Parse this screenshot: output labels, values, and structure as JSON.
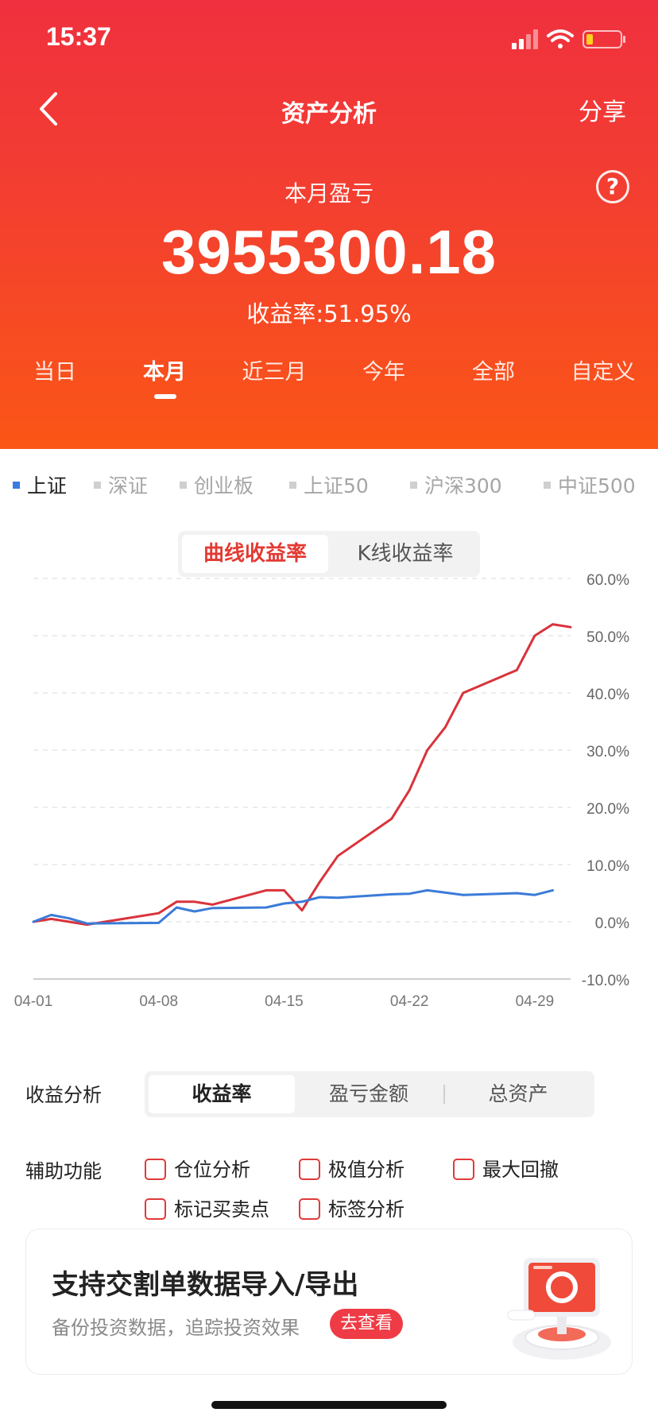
{
  "status_bar": {
    "time": "15:37"
  },
  "nav": {
    "title": "资产分析",
    "share": "分享"
  },
  "summary": {
    "label": "本月盈亏",
    "value": "3955300.18",
    "rate": "收益率:51.95%",
    "help_icon": "?"
  },
  "period_tabs": [
    {
      "label": "当日"
    },
    {
      "label": "本月",
      "active": true
    },
    {
      "label": "近三月"
    },
    {
      "label": "今年"
    },
    {
      "label": "全部"
    },
    {
      "label": "自定义"
    }
  ],
  "index_tabs": [
    {
      "label": "上证",
      "active": true
    },
    {
      "label": "深证"
    },
    {
      "label": "创业板"
    },
    {
      "label": "上证50"
    },
    {
      "label": "沪深300"
    },
    {
      "label": "中证500"
    }
  ],
  "chart_toggle": {
    "active": "曲线收益率",
    "inactive": "K线收益率"
  },
  "chart_data": {
    "type": "line",
    "x_ticks": [
      "04-01",
      "04-08",
      "04-15",
      "04-22",
      "04-29"
    ],
    "y_ticks": [
      "60.0%",
      "50.0%",
      "40.0%",
      "30.0%",
      "20.0%",
      "10.0%",
      "0.0%",
      "-10.0%"
    ],
    "ylim": [
      -10,
      60
    ],
    "grid": true,
    "series": [
      {
        "color": "#d9333b",
        "x": [
          0,
          1,
          3,
          7,
          8,
          9,
          10,
          13,
          14,
          15,
          16,
          17,
          20,
          21,
          22,
          23,
          24,
          27,
          28,
          29,
          30
        ],
        "values": [
          0,
          0.5,
          -0.5,
          1.5,
          3.5,
          3.5,
          3.0,
          5.5,
          5.5,
          2.0,
          7.0,
          11.5,
          18.0,
          23.0,
          30.0,
          34.0,
          40.0,
          44.0,
          50.0,
          52.0,
          51.5
        ]
      },
      {
        "color": "#3b7bd8",
        "x": [
          0,
          1,
          2,
          3,
          7,
          8,
          9,
          10,
          13,
          14,
          15,
          16,
          17,
          20,
          21,
          22,
          23,
          24,
          27,
          28,
          29
        ],
        "values": [
          0,
          1.2,
          0.6,
          -0.3,
          -0.2,
          2.5,
          1.8,
          2.4,
          2.5,
          3.2,
          3.5,
          4.3,
          4.2,
          4.8,
          4.9,
          5.5,
          5.1,
          4.7,
          5.0,
          4.7,
          5.5
        ]
      }
    ]
  },
  "analysis": {
    "label": "收益分析",
    "options": [
      {
        "label": "收益率",
        "active": true
      },
      {
        "label": "盈亏金额"
      },
      {
        "label": "总资产"
      }
    ]
  },
  "aux": {
    "label": "辅助功能",
    "items": [
      {
        "label": "仓位分析"
      },
      {
        "label": "极值分析"
      },
      {
        "label": "最大回撤"
      },
      {
        "label": "标记买卖点"
      },
      {
        "label": "标签分析"
      }
    ]
  },
  "promo": {
    "title": "支持交割单数据导入/导出",
    "subtitle": "备份投资数据，追踪投资效果",
    "button": "去查看"
  }
}
